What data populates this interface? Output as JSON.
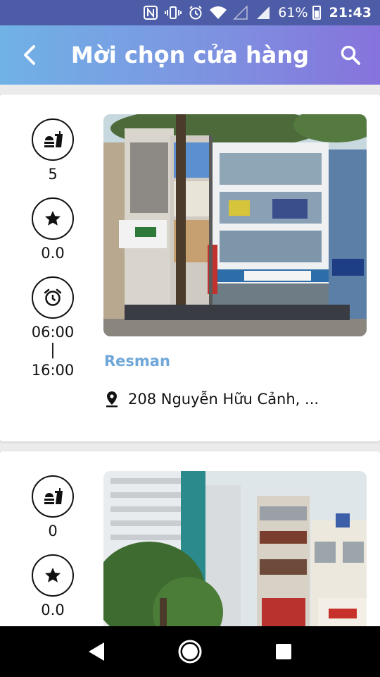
{
  "status_bar": {
    "battery": "61%",
    "time": "21:43"
  },
  "app_bar": {
    "title": "Mời chọn cửa hàng"
  },
  "stores": [
    {
      "dishes": "5",
      "rating": "0.0",
      "open_time": "06:00",
      "separator": "|",
      "close_time": "16:00",
      "name": "Resman",
      "address": "208 Nguyễn Hữu Cảnh, ..."
    },
    {
      "dishes": "0",
      "rating": "0.0"
    }
  ]
}
